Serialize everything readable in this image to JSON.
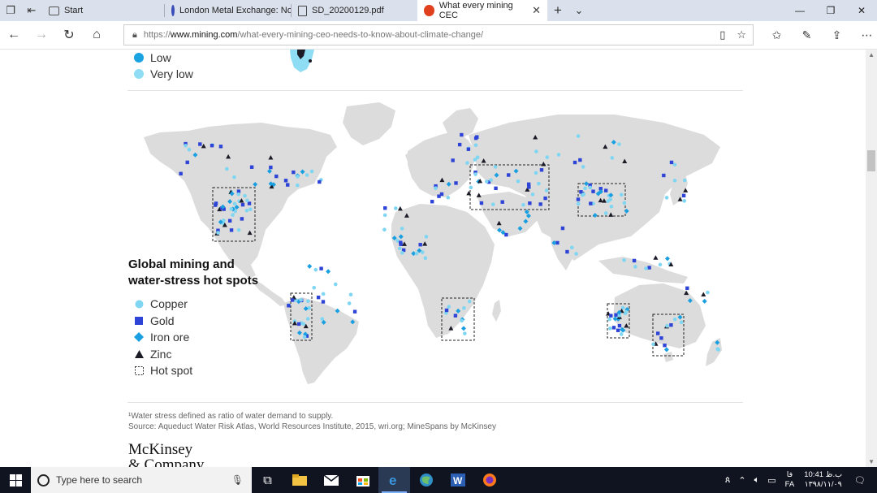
{
  "tabs": [
    {
      "label": "Start",
      "active": false
    },
    {
      "label": "London Metal Exchange: No",
      "active": false
    },
    {
      "label": "SD_20200129.pdf",
      "active": false
    },
    {
      "label": "What every mining CEC",
      "active": true
    }
  ],
  "url": {
    "prefix": "https://",
    "host": "www.mining.com",
    "path": "/what-every-mining-ceo-needs-to-know-about-climate-change/"
  },
  "top_legend": [
    {
      "label": "Low",
      "color": "#19a3e0"
    },
    {
      "label": "Very low",
      "color": "#8fdcf5"
    }
  ],
  "map": {
    "title_line1": "Global mining and",
    "title_line2": "water-stress hot spots",
    "legend": [
      {
        "label": "Copper",
        "symbol": "circle",
        "color": "#7fd6f2"
      },
      {
        "label": "Gold",
        "symbol": "square",
        "color": "#2e44d6"
      },
      {
        "label": "Iron ore",
        "symbol": "diamond",
        "color": "#1a9fe0"
      },
      {
        "label": "Zinc",
        "symbol": "triangle",
        "color": "#1b1b28"
      },
      {
        "label": "Hot spot",
        "symbol": "dashed-box",
        "color": "#333333"
      }
    ]
  },
  "footnote": {
    "line1": "¹Water stress defined as ratio of water demand to supply.",
    "line2": "Source: Aqueduct Water Risk Atlas, World Resources Institute, 2015, wri.org; MineSpans by McKinsey"
  },
  "logo": {
    "line1": "McKinsey",
    "line2": "& Company"
  },
  "taskbar": {
    "search_placeholder": "Type here to search",
    "time": "10:41 ب.ظ",
    "date": "۱۳۹۸/۱۱/۰۹",
    "lang_top": "فا",
    "lang_bottom": "FA"
  },
  "colors": {
    "copper": "#7fd6f2",
    "gold": "#2e44d6",
    "iron": "#1a9fe0",
    "zinc": "#1b1b28",
    "land": "#dcdcdc"
  }
}
